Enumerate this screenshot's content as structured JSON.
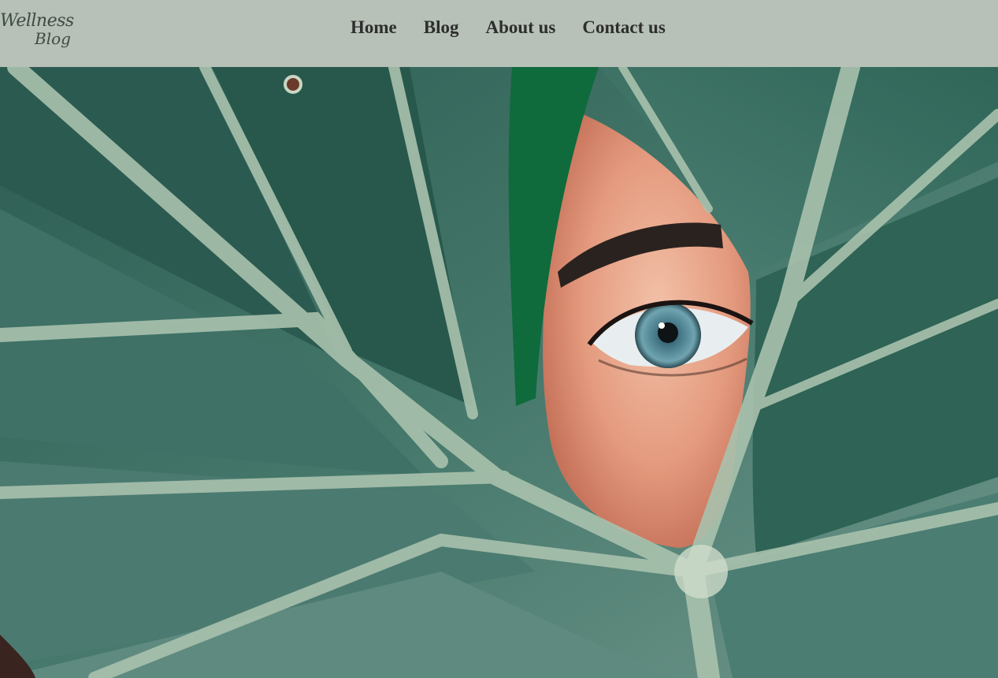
{
  "header": {
    "logo_line1": "Wellness",
    "logo_line2": "Blog"
  },
  "nav": {
    "items": [
      {
        "label": "Home"
      },
      {
        "label": "Blog"
      },
      {
        "label": "About us"
      },
      {
        "label": "Contact us"
      }
    ]
  },
  "hero": {
    "image_semantic": "eye-peeking-through-monstera-leaf-photo"
  },
  "colors": {
    "header_bg": "#b7c1b7",
    "nav_text": "#2e2e2e",
    "leaf_dark": "#2f5e54",
    "leaf_vein": "#a9c2ad",
    "skin": "#e8a58a"
  }
}
